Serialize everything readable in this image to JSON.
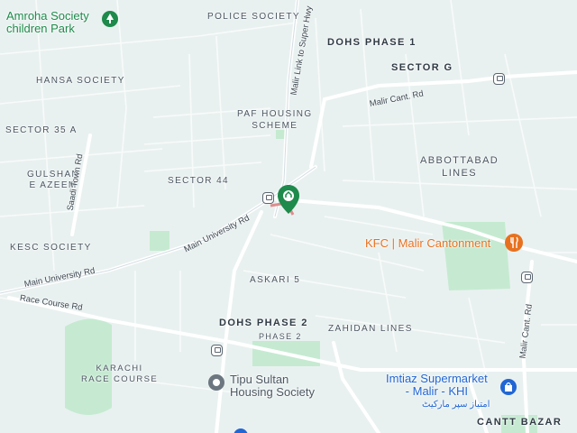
{
  "map": {
    "areas": [
      {
        "key": "police_society",
        "label": "POLICE SOCIETY"
      },
      {
        "key": "dohs_phase_1",
        "label": "DOHS PHASE 1"
      },
      {
        "key": "sector_g",
        "label": "SECTOR G"
      },
      {
        "key": "hansa_society",
        "label": "HANSA SOCIETY"
      },
      {
        "key": "paf_housing",
        "label": "PAF HOUSING\nSCHEME"
      },
      {
        "key": "sector_35a",
        "label": "SECTOR 35 A"
      },
      {
        "key": "abbottabad_lines",
        "label": "ABBOTTABAD\nLINES"
      },
      {
        "key": "gulshan_e_azeem",
        "label": "GULSHAN\nE AZEEM"
      },
      {
        "key": "sector_44",
        "label": "SECTOR 44"
      },
      {
        "key": "kesc_society",
        "label": "KESC SOCIETY"
      },
      {
        "key": "askari_5",
        "label": "ASKARI 5"
      },
      {
        "key": "dohs_phase_2",
        "label": "DOHS PHASE 2"
      },
      {
        "key": "phase_2",
        "label": "PHASE 2"
      },
      {
        "key": "zahidan_lines",
        "label": "ZAHIDAN LINES"
      },
      {
        "key": "karachi_race_course",
        "label": "KARACHI\nRACE COURSE"
      },
      {
        "key": "cantt_bazar",
        "label": "CANTT BAZAR"
      }
    ],
    "streets": {
      "malir_link": "Malir Link to Super Hwy",
      "malir_cant_top": "Malir Cant. Rd",
      "saadi_town": "Saadi Town Rd",
      "main_university_1": "Main University Rd",
      "main_university_2": "Main University Rd",
      "race_course": "Race Course Rd",
      "malir_cant_right": "Malir Cant. Rd"
    },
    "pois": {
      "amroha": {
        "label": "Amroha Society\nchildren Park",
        "icon": "park-tree-icon"
      },
      "kfc": {
        "label": "KFC | Malir Cantonment",
        "icon": "restaurant-icon"
      },
      "imtiaz": {
        "label": "Imtiaz Supermarket\n- Malir - KHI",
        "urdu": "امتیاز سپر مارکیٹ",
        "icon": "shopping-bag-icon"
      },
      "tipu": {
        "label": "Tipu Sultan\nHousing Society",
        "icon": "location-pin-icon"
      }
    },
    "colors": {
      "background": "#e9f1f0",
      "road": "#ffffff",
      "major_road": "#c9d6dc",
      "park": "#c5ead1",
      "pin": "#1e8a4b",
      "food": "#e8711f",
      "shop": "#2166d4"
    }
  }
}
